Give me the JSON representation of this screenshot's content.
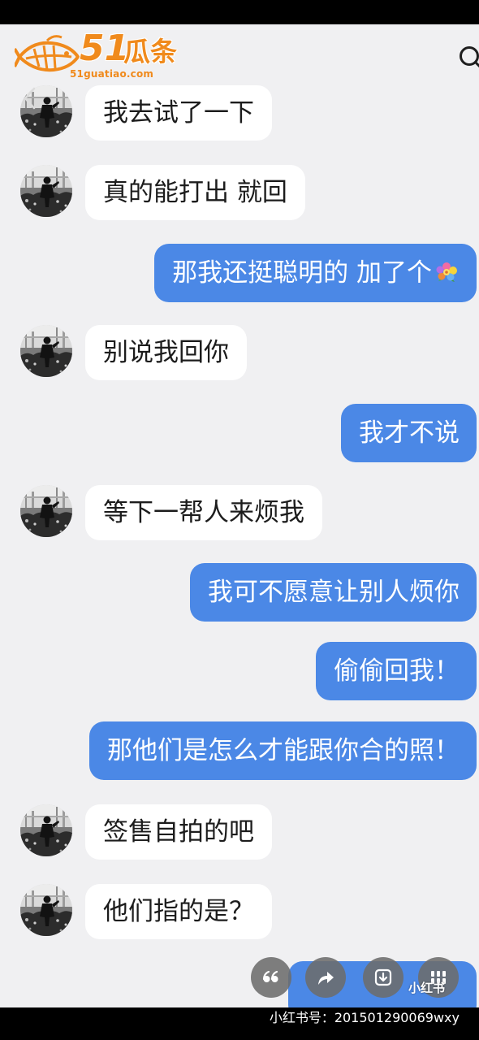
{
  "watermark": {
    "number": "51",
    "name": "瓜条",
    "domain": "51guatiao.com"
  },
  "header": {
    "back_icon": "back-chevron-icon",
    "search_icon": "search-icon"
  },
  "messages": [
    {
      "text": "我去试了一下"
    },
    {
      "text": "真的能打出 就回"
    },
    {
      "text": "那我还挺聪明的 加了个",
      "emoji_icon": "flower-emoji-icon"
    },
    {
      "text": "别说我回你"
    },
    {
      "text": "我才不说"
    },
    {
      "text": "等下一帮人来烦我"
    },
    {
      "text": "我可不愿意让别人烦你"
    },
    {
      "text": "偷偷回我！"
    },
    {
      "text": "那他们是怎么才能跟你合的照！"
    },
    {
      "text": "签售自拍的吧"
    },
    {
      "text": "他们指的是？"
    }
  ],
  "actions": [
    {
      "icon": "quote-icon"
    },
    {
      "icon": "share-icon"
    },
    {
      "icon": "download-icon"
    },
    {
      "icon": "grid-icon"
    }
  ],
  "overlay": {
    "logo_text": "小红书"
  },
  "footer": {
    "account_id": "小红书号：201501290069wxy"
  },
  "colors": {
    "background": "#f0f0f2",
    "received_bubble": "#ffffff",
    "sent_bubble": "#4b88e6",
    "watermark": "#f08a1c",
    "bars": "#000000"
  }
}
